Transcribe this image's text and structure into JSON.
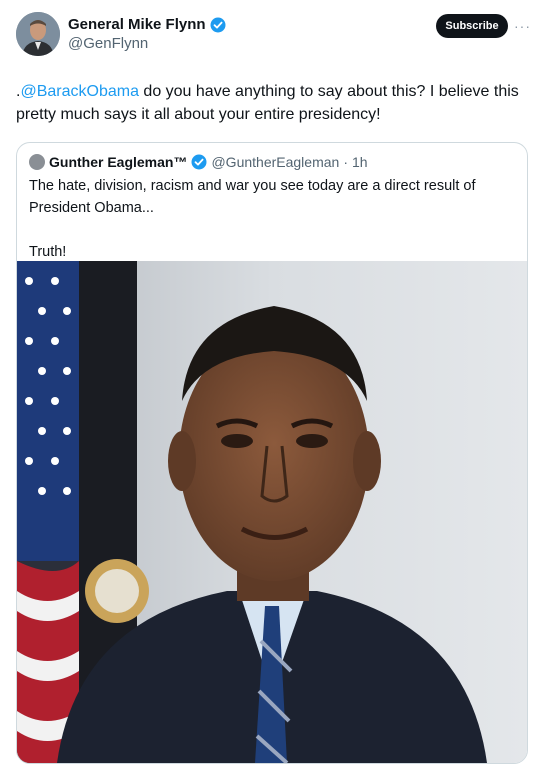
{
  "tweet": {
    "author_name": "General Mike Flynn",
    "author_handle": "@GenFlynn",
    "subscribe_label": "Subscribe",
    "more_label": "···",
    "text_prefix": ".",
    "mention": "@BarackObama",
    "text_body": " do you have anything to say about this? I believe this pretty much says it all about your entire presidency!"
  },
  "quoted": {
    "author_name": "Gunther Eagleman™",
    "author_handle": "@GuntherEagleman",
    "separator": "·",
    "time": "1h",
    "line1": "The hate, division, racism and war you see today are a direct result of President Obama...",
    "line2": "Truth!"
  },
  "colors": {
    "accent": "#1d9bf0",
    "text": "#0f1419",
    "muted": "#536471",
    "border": "#cfd9de"
  },
  "icons": {
    "verified": "verified-badge-icon",
    "more": "more-options-icon"
  }
}
